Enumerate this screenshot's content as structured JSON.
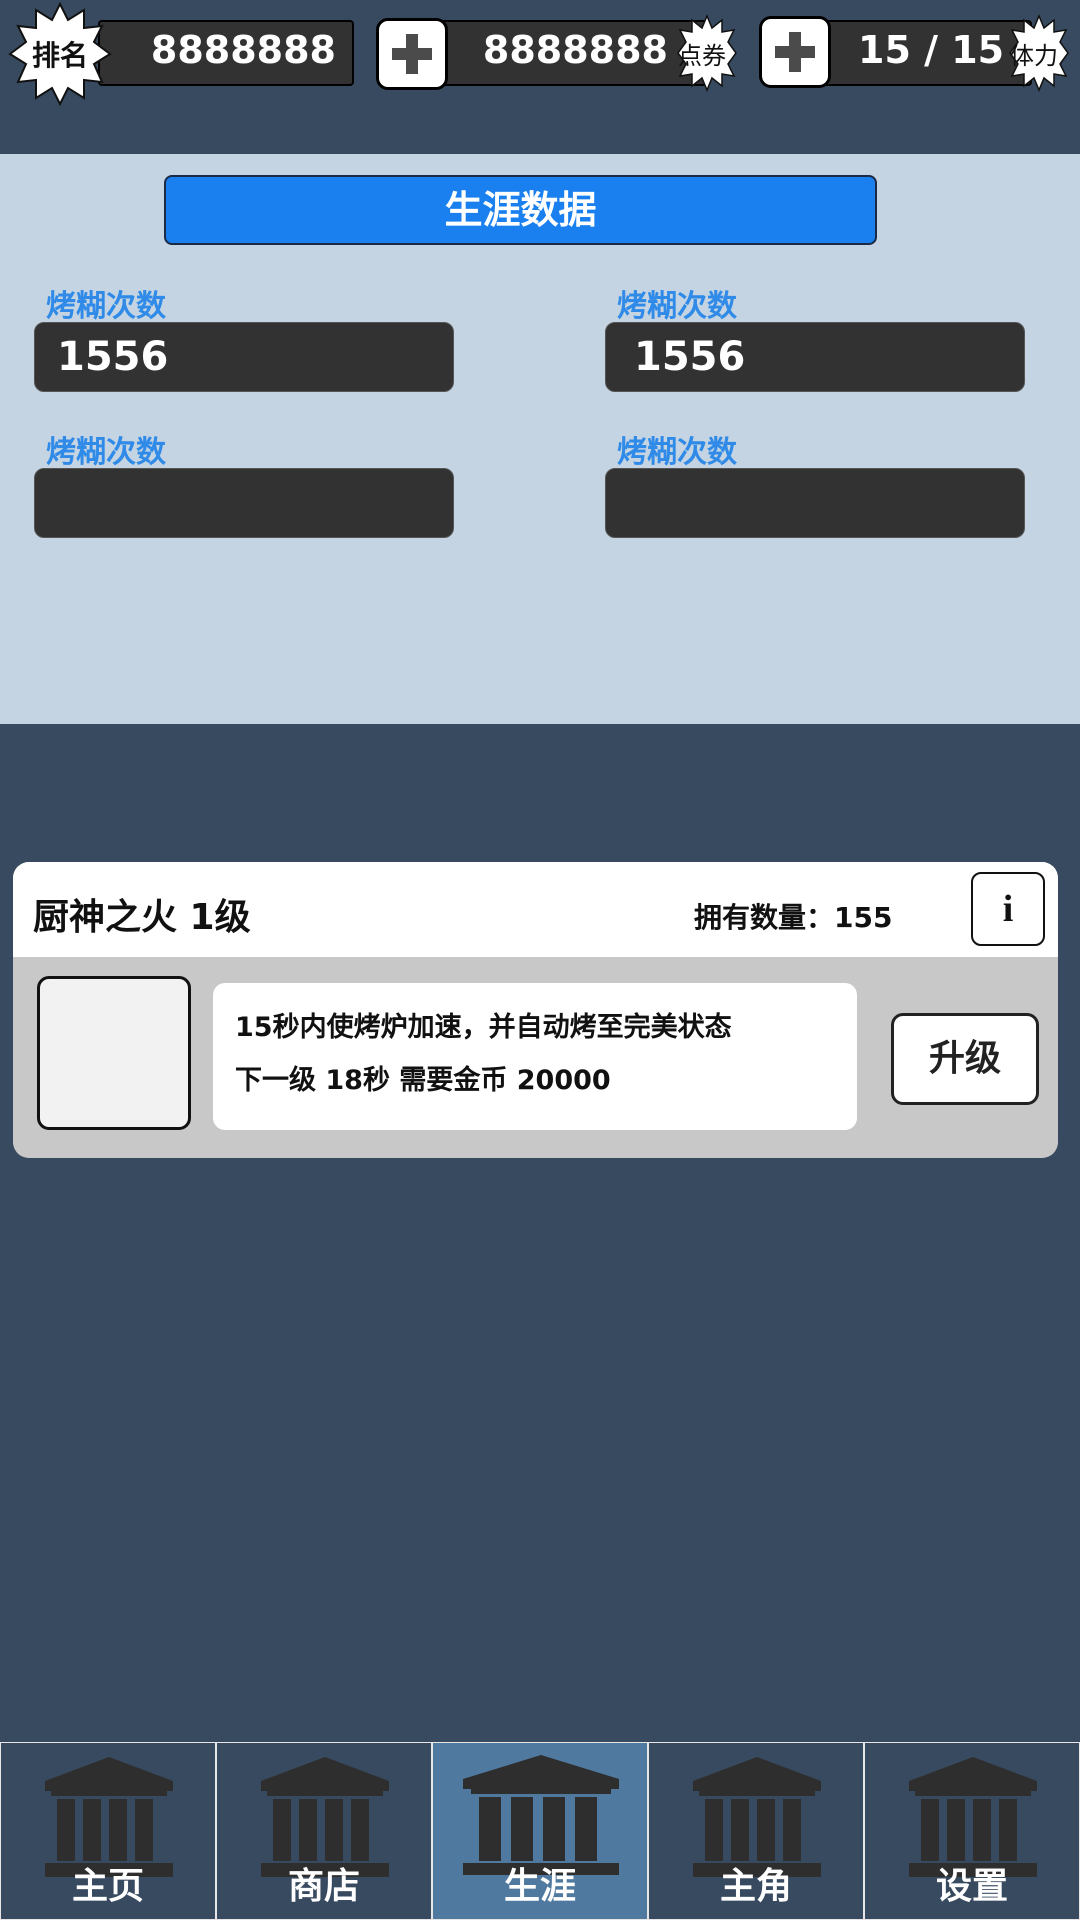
{
  "top_bar": {
    "rank_badge": "排名",
    "rank_value": "8888888",
    "coupon_value": "8888888",
    "coupon_badge": "点券",
    "stamina_value": "15 / 15",
    "stamina_badge": "体力"
  },
  "career": {
    "title": "生涯数据",
    "stats": [
      {
        "label": "烤糊次数",
        "value": "1556"
      },
      {
        "label": "烤糊次数",
        "value": "1556"
      },
      {
        "label": "烤糊次数",
        "value": ""
      },
      {
        "label": "烤糊次数",
        "value": ""
      }
    ]
  },
  "skill_card": {
    "title": "厨神之火 1级",
    "owned": "拥有数量：155",
    "info_label": "i",
    "description_line1": "15秒内使烤炉加速，并自动烤至完美状态",
    "description_line2": "下一级 18秒 需要金币 20000",
    "upgrade_label": "升级"
  },
  "nav": {
    "items": [
      {
        "label": "主页",
        "icon": "building-icon"
      },
      {
        "label": "商店",
        "icon": "building-icon"
      },
      {
        "label": "生涯",
        "icon": "building-icon",
        "active": true
      },
      {
        "label": "主角",
        "icon": "building-icon"
      },
      {
        "label": "设置",
        "icon": "building-icon"
      }
    ]
  },
  "colors": {
    "background": "#384a5f",
    "panel": "#c4d4e2",
    "accent_blue": "#1a80ef",
    "label_blue": "#2f8ae8",
    "nav_active": "#5079a0"
  }
}
